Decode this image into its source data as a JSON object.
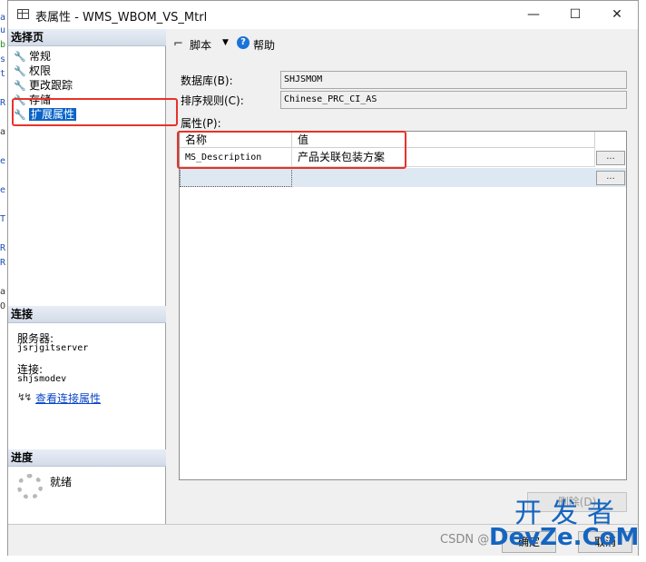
{
  "window": {
    "title": "表属性 - WMS_WBOM_VS_Mtrl",
    "minimize": "—",
    "maximize": "☐",
    "close": "✕"
  },
  "left": {
    "select_page_header": "选择页",
    "pages": [
      {
        "label": "常规"
      },
      {
        "label": "权限"
      },
      {
        "label": "更改跟踪"
      },
      {
        "label": "存储"
      },
      {
        "label": "扩展属性",
        "selected": true
      }
    ],
    "connection_header": "连接",
    "server_label": "服务器:",
    "server_value": "jsrjgitserver",
    "connection_label": "连接:",
    "connection_value": "shjsmodev",
    "view_conn_props": "查看连接属性",
    "progress_header": "进度",
    "progress_status": "就绪"
  },
  "toolbar": {
    "script": "脚本",
    "help": "帮助"
  },
  "fields": {
    "database_label": "数据库(B):",
    "database_value": "SHJSMOM",
    "collation_label": "排序规则(C):",
    "collation_value": "Chinese_PRC_CI_AS",
    "properties_label": "属性(P):"
  },
  "grid": {
    "col_name": "名称",
    "col_value": "值",
    "rows": [
      {
        "name": "MS_Description",
        "value": "产品关联包装方案"
      }
    ],
    "dots": "..."
  },
  "buttons": {
    "delete": "删除(D)",
    "ok": "确定",
    "cancel": "取消"
  },
  "watermark": {
    "csdn": "CSDN @",
    "brand_top": "开发者",
    "brand_bottom": "DevZe.CoM"
  },
  "colors": {
    "selection": "#0a64c8",
    "link": "#0a46c8",
    "highlight_box": "#e8322a",
    "brand": "#1565c0"
  }
}
